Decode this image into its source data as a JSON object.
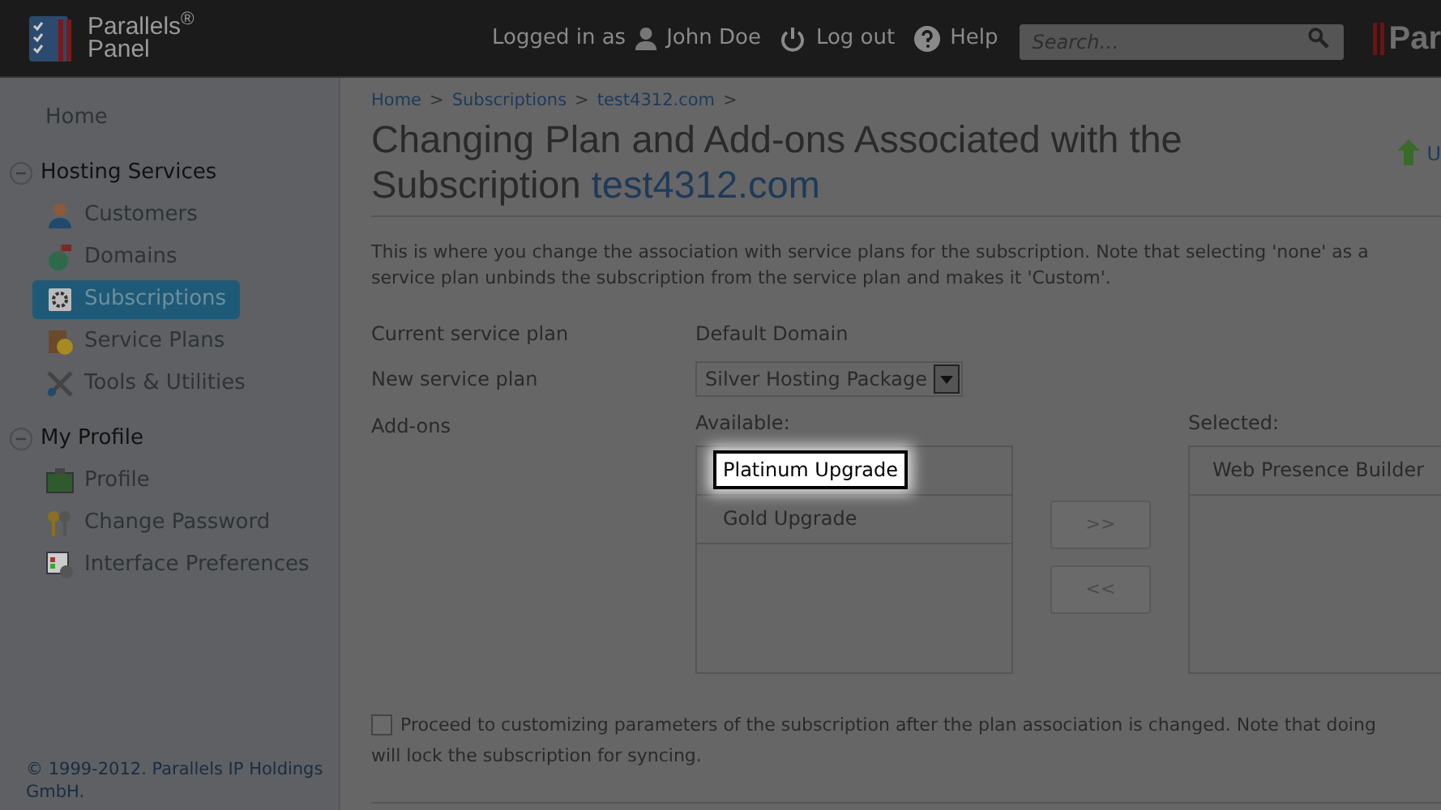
{
  "header": {
    "brand": "Parallels$^{®}$",
    "brand_sub": "Panel",
    "logged_in_label": "Logged in as",
    "user": "John Doe",
    "logout": "Log out",
    "help": "Help",
    "search": {
      "placeholder": "Search…"
    },
    "brand_partial": "Par"
  },
  "sidebar": {
    "home": {
      "label": "Home",
      "selected": false
    },
    "groups": [
      {
        "title": "Hosting Services",
        "expanded": true,
        "items": [
          {
            "label": "Customers",
            "selected": false
          },
          {
            "label": "Domains",
            "selected": false
          },
          {
            "label": "Subscriptions",
            "selected": true
          },
          {
            "label": "Service Plans",
            "selected": false
          },
          {
            "label": "Tools & Utilities",
            "selected": false
          }
        ]
      },
      {
        "title": "My Profile",
        "expanded": true,
        "items": [
          {
            "label": "Profile",
            "selected": false
          },
          {
            "label": "Change Password",
            "selected": false
          },
          {
            "label": "Interface Preferences",
            "selected": false
          }
        ]
      }
    ],
    "footer": "© 1999-2012. Parallels IP Holdings GmbH."
  },
  "breadcrumbs": [
    {
      "label": "Home",
      "separator": ">"
    },
    {
      "label": "Subscriptions",
      "separator": ">"
    },
    {
      "label": "test4312.com",
      "separator": ">"
    }
  ],
  "title": {
    "text": "Changing Plan and Add-ons Associated with the Subscription",
    "domain": "test4312.com"
  },
  "header_action": {
    "label": "U"
  },
  "description_lines": [
    "This is where you change the association with service plans for the subscription. Note that selecting 'none' as a",
    "service plan unbinds the subscription from the service plan and makes it 'Custom'."
  ],
  "form": {
    "current_plan": {
      "label": "Current service plan",
      "value": "Default Domain"
    },
    "new_plan": {
      "label": "New service plan",
      "value": "Silver Hosting Package"
    },
    "addons": {
      "label": "Add-ons",
      "available_label": "Available:",
      "selected_label": "Selected:",
      "available": [
        {
          "label": "Platinum Upgrade",
          "highlighted": true
        },
        {
          "label": "Gold Upgrade",
          "highlighted": false
        }
      ],
      "selected": [
        {
          "label": "Web Presence Builder",
          "highlighted": false
        }
      ],
      "add_button": ">>",
      "remove_button": "<<"
    }
  },
  "customize": {
    "checked": false,
    "lines": [
      "Proceed to customizing parameters of the subscription after the plan association is changed. Note that doing",
      "will lock the subscription for syncing."
    ]
  }
}
